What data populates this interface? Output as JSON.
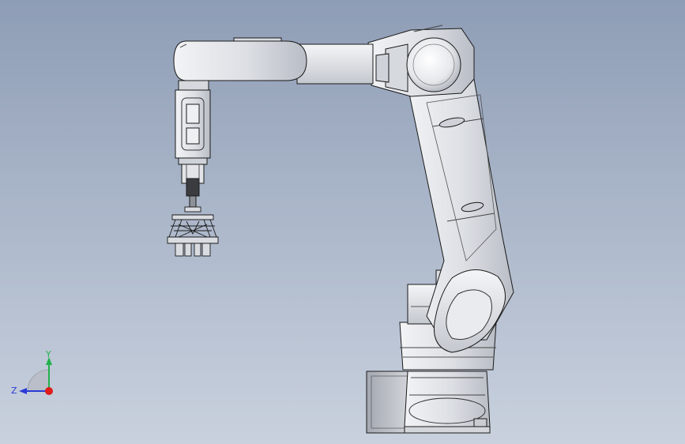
{
  "viewport": {
    "background_top": "#8e9db6",
    "background_bottom": "#c9d1de"
  },
  "triad": {
    "y_label": "Y",
    "z_label": "Z",
    "y_color": "#22b14c",
    "z_color": "#2a3bd6",
    "x_color": "#e01b1b"
  },
  "model": {
    "part_fill": "#e4e6ea",
    "part_shade": "#c7cad0",
    "edge_color": "#1a1a1a"
  }
}
